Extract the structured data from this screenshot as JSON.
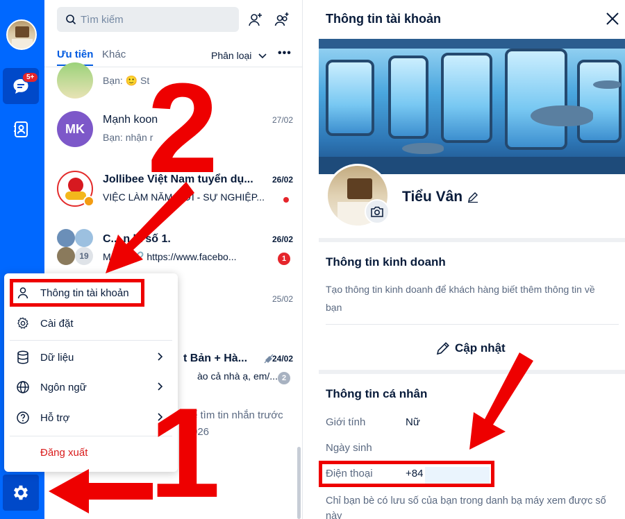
{
  "nav": {
    "chat_badge": "5+"
  },
  "list": {
    "search_placeholder": "Tìm kiếm",
    "tabs": {
      "priority": "Ưu tiên",
      "other": "Khác"
    },
    "sort_label": "Phân loại",
    "more_label": "•••",
    "rows": [
      {
        "name": "",
        "preview": "Bạn: 🙂 St",
        "time": ""
      },
      {
        "avatar_text": "MK",
        "name": "Mạnh koon",
        "preview": "Bạn: nhận r",
        "time": "27/02"
      },
      {
        "name": "Jollibee Việt Nam tuyển dụ...",
        "preview": "VIỆC LÀM NĂM MỚI - SỰ NGHIỆP...",
        "time": "26/02"
      },
      {
        "name": "C... n là số 1.",
        "preview": "M... y: 🔗 https://www.facebo...",
        "time": "26/02",
        "unread": "1",
        "group_count": "19"
      },
      {
        "name": "",
        "preview": "",
        "time": "25/02"
      },
      {
        "name": "t Bản + Hà...",
        "preview": "ào cả nhà ạ, em/...",
        "time": "24/02",
        "unread": "2"
      }
    ],
    "footer_text_1": "ể tìm tin nhắn trước",
    "footer_text_2": "026"
  },
  "menu": {
    "account_info": "Thông tin tài khoản",
    "settings": "Cài đặt",
    "data": "Dữ liệu",
    "language": "Ngôn ngữ",
    "support": "Hỗ trợ",
    "logout": "Đăng xuất"
  },
  "panel": {
    "title": "Thông tin tài khoản",
    "profile_name": "Tiểu Vân",
    "business_title": "Thông tin kinh doanh",
    "business_desc": "Tạo thông tin kinh doanh để khách hàng biết thêm thông tin về bạn",
    "update_label": "Cập nhật",
    "personal_title": "Thông tin cá nhân",
    "gender_label": "Giới tính",
    "gender_value": "Nữ",
    "birthday_label": "Ngày sinh",
    "phone_label": "Điện thoại",
    "phone_value": "+84",
    "phone_note": "Chỉ bạn bè có lưu số của bạn trong danh bạ máy xem được số này"
  },
  "annotations": {
    "step_one": "1",
    "step_two": "2"
  },
  "colors": {
    "brand_blue": "#0068ff",
    "annotation_red": "#ee0000"
  }
}
